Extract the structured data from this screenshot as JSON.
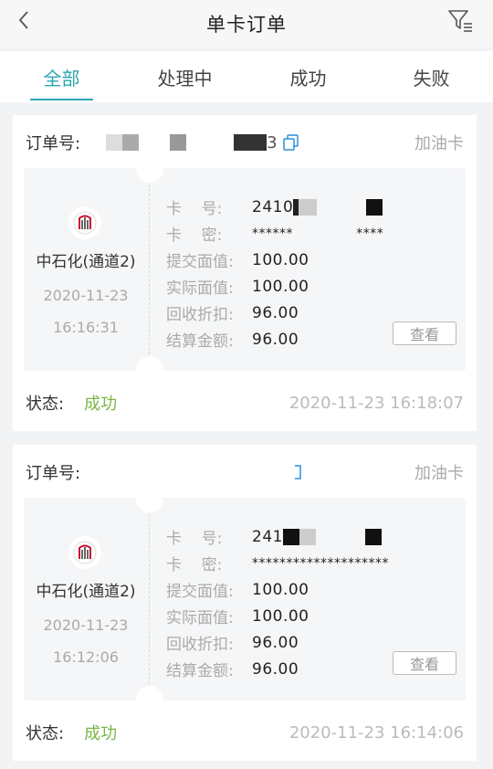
{
  "header": {
    "title": "单卡订单",
    "back_icon": "chevron-left-icon",
    "filter_icon": "filter-icon"
  },
  "tabs": [
    {
      "label": "全部",
      "active": true
    },
    {
      "label": "处理中",
      "active": false
    },
    {
      "label": "成功",
      "active": false
    },
    {
      "label": "失败",
      "active": false
    }
  ],
  "labels": {
    "order_no": "订单号:",
    "card_no": "卡    号:",
    "card_pwd": "卡    密:",
    "submit_value": "提交面值:",
    "actual_value": "实际面值:",
    "discount": "回收折扣:",
    "settle": "结算金额:",
    "status": "状态:",
    "view": "查看"
  },
  "orders": [
    {
      "order_no": "3",
      "type": "加油卡",
      "channel": "中石化(通道2)",
      "date": "2020-11-23",
      "time": "16:16:31",
      "card_no": "2410",
      "card_pwd": "******              ****",
      "submit_value": "100.00",
      "actual_value": "100.00",
      "discount": "96.00",
      "settle": "96.00",
      "status": "成功",
      "status_time": "2020-11-23 16:18:07"
    },
    {
      "order_no": "",
      "type": "加油卡",
      "channel": "中石化(通道2)",
      "date": "2020-11-23",
      "time": "16:12:06",
      "card_no": "241",
      "card_pwd": "********************",
      "submit_value": "100.00",
      "actual_value": "100.00",
      "discount": "96.00",
      "settle": "96.00",
      "status": "成功",
      "status_time": "2020-11-23 16:14:06"
    }
  ],
  "colors": {
    "accent": "#2aa6b0",
    "success": "#7ab648"
  }
}
